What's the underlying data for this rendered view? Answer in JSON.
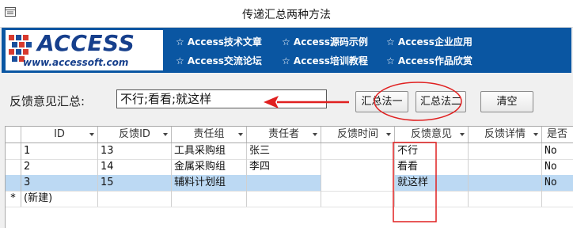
{
  "window": {
    "title": "传递汇总两种方法"
  },
  "banner": {
    "logo_name": "ACCESS",
    "logo_url": "www.accessoft.com",
    "links": [
      "☆ Access技术文章",
      "☆ Access源码示例",
      "☆ Access企业应用",
      "☆ Access交流论坛",
      "☆ Access培训教程",
      "☆ Access作品欣赏"
    ]
  },
  "summary": {
    "label": "反馈意见汇总:",
    "value": "不行;看看;就这样"
  },
  "buttons": {
    "method1": "汇总法一",
    "method2": "汇总法二",
    "clear": "清空"
  },
  "table": {
    "columns": [
      "ID",
      "反馈ID",
      "责任组",
      "责任者",
      "反馈时间",
      "反馈意见",
      "反馈详情",
      "是否"
    ],
    "rows": [
      {
        "id": "1",
        "fid": "13",
        "group": "工具采购组",
        "person": "张三",
        "time": "",
        "opinion": "不行",
        "detail": "",
        "flag": "No"
      },
      {
        "id": "2",
        "fid": "14",
        "group": "金属采购组",
        "person": "李四",
        "time": "",
        "opinion": "看看",
        "detail": "",
        "flag": "No"
      },
      {
        "id": "3",
        "fid": "15",
        "group": "辅料计划组",
        "person": "",
        "time": "",
        "opinion": "就这样",
        "detail": "",
        "flag": "No"
      }
    ],
    "new_row_marker": "*",
    "new_row_label": "(新建)"
  },
  "colors": {
    "banner": "#0a56a2",
    "selected_row": "#bcd9f3",
    "annotation": "#e02020"
  }
}
